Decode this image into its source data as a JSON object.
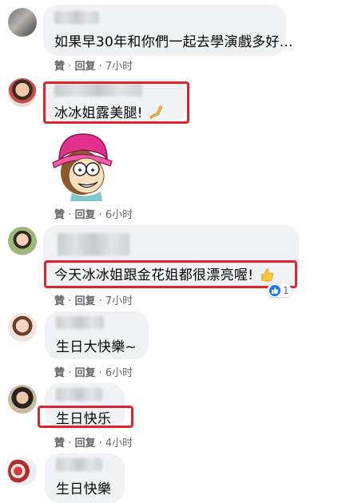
{
  "comments": [
    {
      "text": "如果早30年和你們一起去學演戲多好...",
      "like": "贊",
      "reply": "回复",
      "time": "7小时"
    },
    {
      "text": "冰冰姐露美腿!",
      "like": "贊",
      "reply": "回复",
      "time": "6小时"
    },
    {
      "text": "今天冰冰姐跟金花姐都很漂亮喔!",
      "like": "贊",
      "reply": "回复",
      "time": "7小时",
      "reaction_count": "1"
    },
    {
      "text": "生日大快樂~",
      "like": "贊",
      "reply": "回复",
      "time": "6小时"
    },
    {
      "text": "生日快乐",
      "like": "贊",
      "reply": "回复",
      "time": "4小时"
    },
    {
      "text": "生日快樂"
    }
  ],
  "separator": "·",
  "colors": {
    "highlight_box": "#e0242b",
    "bubble": "#f0f2f5",
    "meta_text": "#65676b",
    "like_blue": "#1877f2"
  },
  "icons": [
    "leg-emoji-icon",
    "thumbs-up-emoji-icon",
    "like-reaction-icon",
    "cartoon-sticker"
  ]
}
